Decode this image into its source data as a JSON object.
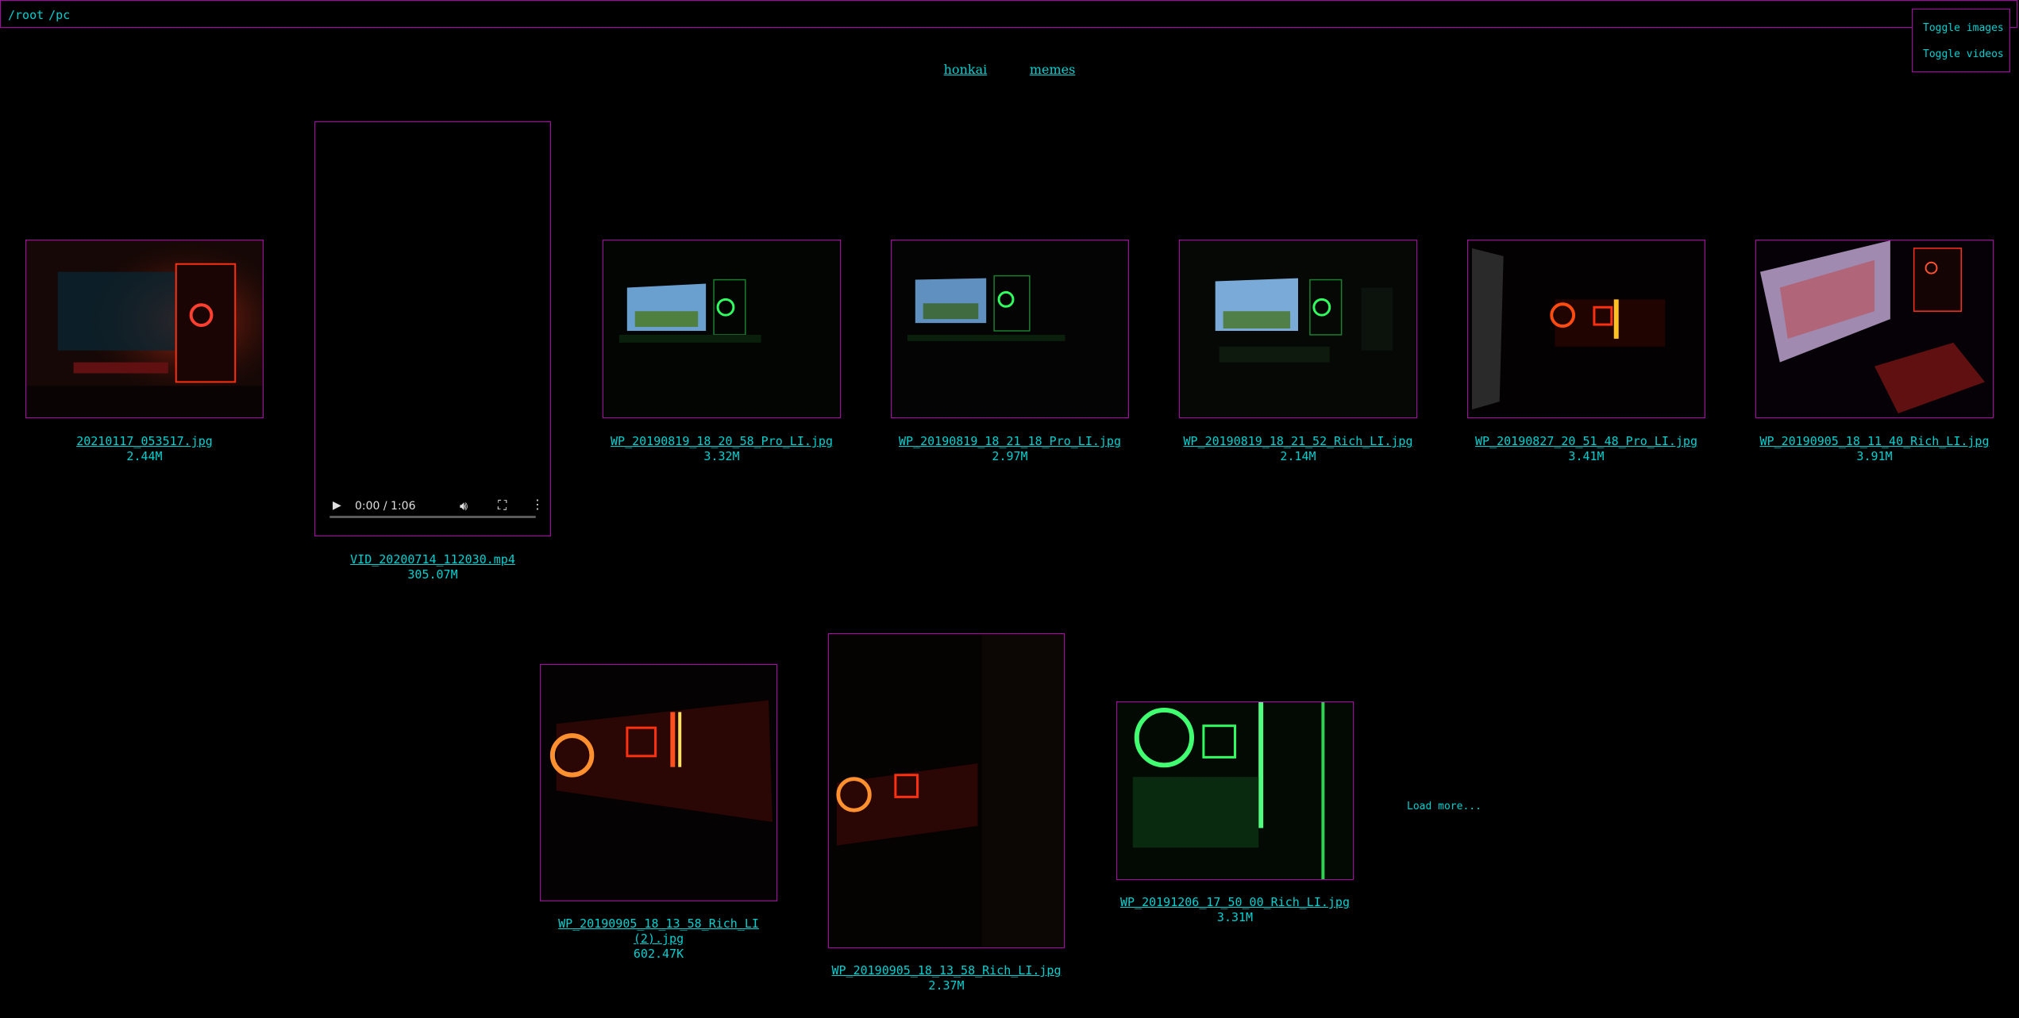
{
  "breadcrumb": [
    "/root",
    "/pc"
  ],
  "toggles": {
    "images": "Toggle images",
    "videos": "Toggle videos"
  },
  "subdirs": [
    "honkai",
    "memes"
  ],
  "items": [
    {
      "name": "20210117_053517.jpg",
      "size": "2.44M",
      "type": "image"
    },
    {
      "name": "VID_20200714_112030.mp4",
      "size": "305.07M",
      "type": "video"
    },
    {
      "name": "WP_20190819_18_20_58_Pro_LI.jpg",
      "size": "3.32M",
      "type": "image"
    },
    {
      "name": "WP_20190819_18_21_18_Pro_LI.jpg",
      "size": "2.97M",
      "type": "image"
    },
    {
      "name": "WP_20190819_18_21_52_Rich_LI.jpg",
      "size": "2.14M",
      "type": "image"
    },
    {
      "name": "WP_20190827_20_51_48_Pro_LI.jpg",
      "size": "3.41M",
      "type": "image"
    },
    {
      "name": "WP_20190905_18_11_40_Rich_LI.jpg",
      "size": "3.91M",
      "type": "image"
    },
    {
      "name": "WP_20190905_18_13_58_Rich_LI (2).jpg",
      "name_line1": "WP_20190905_18_13_58_Rich_LI",
      "name_line2": "(2).jpg",
      "size": "602.47K",
      "type": "image"
    },
    {
      "name": "WP_20190905_18_13_58_Rich_LI.jpg",
      "size": "2.37M",
      "type": "image"
    },
    {
      "name": "WP_20191206_17_50_00_Rich_LI.jpg",
      "size": "3.31M",
      "type": "image"
    }
  ],
  "video_player": {
    "time": "0:00 / 1:06",
    "progress": 0
  },
  "load_more": "Load more...",
  "colors": {
    "background": "#000000",
    "border": "#b000b0",
    "link": "#00d0d0"
  }
}
